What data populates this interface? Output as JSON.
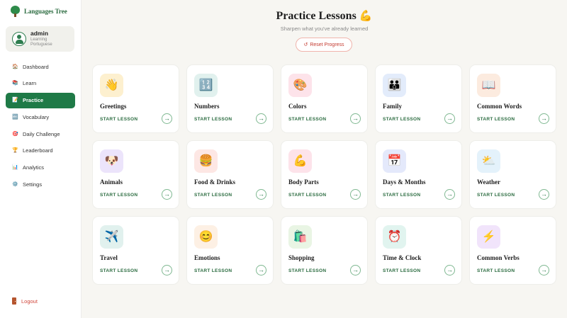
{
  "brand": {
    "name": "Languages Tree",
    "icon": "tree-icon"
  },
  "user": {
    "name": "admin",
    "subtitle": "Learning Portuguese"
  },
  "nav": [
    {
      "label": "Dashboard",
      "icon": "🏠",
      "active": false
    },
    {
      "label": "Learn",
      "icon": "📚",
      "active": false
    },
    {
      "label": "Practice",
      "icon": "📝",
      "active": true
    },
    {
      "label": "Vocabulary",
      "icon": "🔤",
      "active": false
    },
    {
      "label": "Daily Challenge",
      "icon": "🎯",
      "active": false
    },
    {
      "label": "Leaderboard",
      "icon": "🏆",
      "active": false
    },
    {
      "label": "Analytics",
      "icon": "📊",
      "active": false
    },
    {
      "label": "Settings",
      "icon": "⚙️",
      "active": false
    }
  ],
  "logout": {
    "label": "Logout"
  },
  "header": {
    "title": "Practice Lessons",
    "title_emoji": "💪",
    "subtitle": "Sharpen what you've already learned",
    "reset_label": "Reset Progress",
    "reset_icon": "↺"
  },
  "start_label": "START LESSON",
  "lessons": [
    {
      "title": "Greetings",
      "icon": "👋",
      "bg": "#fdf0cf"
    },
    {
      "title": "Numbers",
      "icon": "🔢",
      "bg": "#e1f1ee"
    },
    {
      "title": "Colors",
      "icon": "🎨",
      "bg": "#fde3ea"
    },
    {
      "title": "Family",
      "icon": "👪",
      "bg": "#e3ecfb"
    },
    {
      "title": "Common Words",
      "icon": "📖",
      "bg": "#fcebdf"
    },
    {
      "title": "Animals",
      "icon": "🐶",
      "bg": "#ece4fb"
    },
    {
      "title": "Food & Drinks",
      "icon": "🍔",
      "bg": "#fde7e4"
    },
    {
      "title": "Body Parts",
      "icon": "💪",
      "bg": "#fde3ea"
    },
    {
      "title": "Days & Months",
      "icon": "📅",
      "bg": "#e4e9fb"
    },
    {
      "title": "Weather",
      "icon": "⛅",
      "bg": "#e4f2fb"
    },
    {
      "title": "Travel",
      "icon": "✈️",
      "bg": "#e1f1ee"
    },
    {
      "title": "Emotions",
      "icon": "😊",
      "bg": "#fdf0e4"
    },
    {
      "title": "Shopping",
      "icon": "🛍️",
      "bg": "#e9f5e4"
    },
    {
      "title": "Time & Clock",
      "icon": "⏰",
      "bg": "#e1f4ef"
    },
    {
      "title": "Common Verbs",
      "icon": "⚡",
      "bg": "#f1e4fb"
    }
  ],
  "colors": {
    "accent": "#1f7a47",
    "danger": "#d0453a",
    "background": "#f7f6f2"
  }
}
